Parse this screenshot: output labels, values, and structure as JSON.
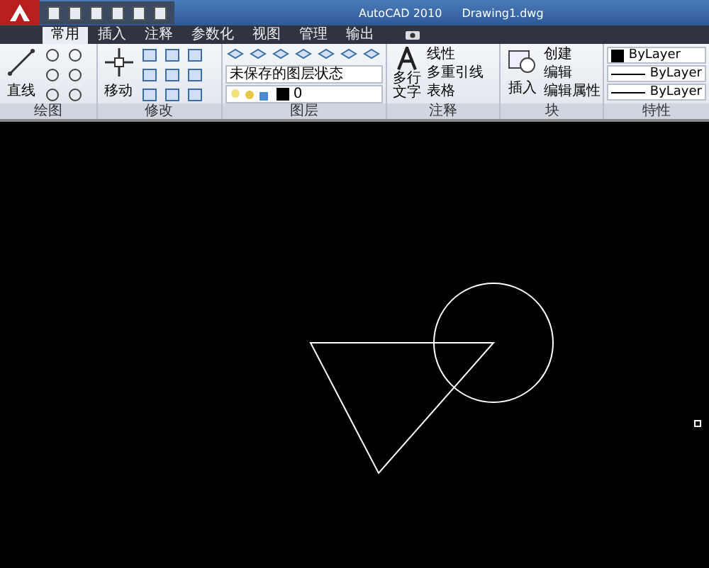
{
  "title_bar": {
    "app": "AutoCAD 2010",
    "file": "Drawing1.dwg"
  },
  "tabs": [
    {
      "label": "常用",
      "selected": true
    },
    {
      "label": "插入",
      "selected": false
    },
    {
      "label": "注释",
      "selected": false
    },
    {
      "label": "参数化",
      "selected": false
    },
    {
      "label": "视图",
      "selected": false
    },
    {
      "label": "管理",
      "selected": false
    },
    {
      "label": "输出",
      "selected": false
    }
  ],
  "panels": {
    "draw": {
      "title": "绘图",
      "big_button": "直线"
    },
    "modify": {
      "title": "修改",
      "big_button": "移动"
    },
    "layers": {
      "title": "图层",
      "state_dropdown": "未保存的图层状态",
      "current_layer": "0"
    },
    "annotation": {
      "title": "注释",
      "big_button": "多行文字",
      "items": [
        "线性",
        "多重引线",
        "表格"
      ]
    },
    "block": {
      "title": "块",
      "big_button": "插入",
      "items": [
        "创建",
        "编辑",
        "编辑属性"
      ]
    },
    "properties": {
      "title": "特性",
      "rows": [
        "ByLayer",
        "ByLayer",
        "ByLayer"
      ]
    }
  }
}
